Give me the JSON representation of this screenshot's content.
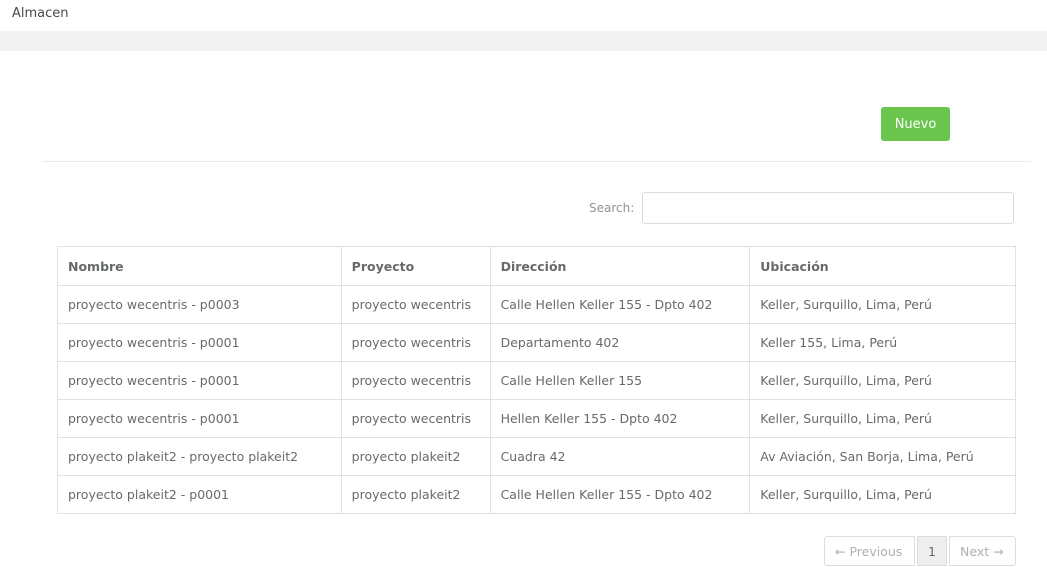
{
  "app": {
    "title": "Almacen"
  },
  "toolbar": {
    "new_label": "Nuevo"
  },
  "search": {
    "label": "Search:",
    "value": ""
  },
  "table": {
    "headers": [
      "Nombre",
      "Proyecto",
      "Dirección",
      "Ubicación"
    ],
    "rows": [
      [
        "proyecto wecentris - p0003",
        "proyecto wecentris",
        "Calle Hellen Keller 155 - Dpto 402",
        "Keller, Surquillo, Lima, Perú"
      ],
      [
        "proyecto wecentris - p0001",
        "proyecto wecentris",
        "Departamento 402",
        "Keller 155, Lima, Perú"
      ],
      [
        "proyecto wecentris - p0001",
        "proyecto wecentris",
        "Calle Hellen Keller 155",
        "Keller, Surquillo, Lima, Perú"
      ],
      [
        "proyecto wecentris - p0001",
        "proyecto wecentris",
        "Hellen Keller 155 - Dpto 402",
        "Keller, Surquillo, Lima, Perú"
      ],
      [
        "proyecto plakeit2 - proyecto plakeit2",
        "proyecto plakeit2",
        "Cuadra 42",
        "Av Aviación, San Borja, Lima, Perú"
      ],
      [
        "proyecto plakeit2 - p0001",
        "proyecto plakeit2",
        "Calle Hellen Keller 155 - Dpto 402",
        "Keller, Surquillo, Lima, Perú"
      ]
    ]
  },
  "pagination": {
    "previous": "← Previous",
    "current": "1",
    "next": "Next →"
  },
  "colors": {
    "accent": "#69c54e",
    "band": "#f3f3f4"
  }
}
